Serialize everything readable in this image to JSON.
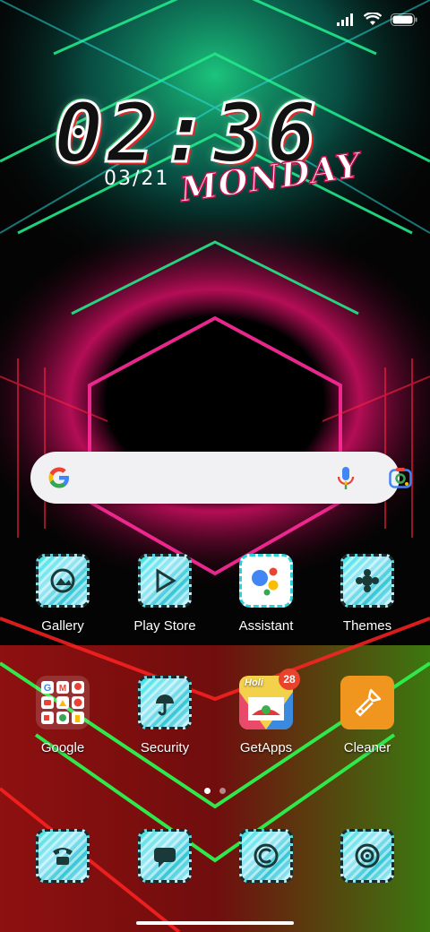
{
  "status_bar": {
    "icons": [
      "signal-icon",
      "wifi-icon",
      "battery-icon"
    ]
  },
  "clock_widget": {
    "time": "02:36",
    "date": "03/21",
    "day": "MONDAY"
  },
  "search_bar": {
    "icons": [
      "google-g-icon",
      "microphone-icon",
      "google-lens-icon"
    ]
  },
  "home_apps": [
    {
      "label": "Gallery",
      "icon": "gallery-icon"
    },
    {
      "label": "Play Store",
      "icon": "play-store-icon"
    },
    {
      "label": "Assistant",
      "icon": "assistant-icon"
    },
    {
      "label": "Themes",
      "icon": "themes-icon"
    },
    {
      "label": "Google",
      "icon": "google-folder-icon"
    },
    {
      "label": "Security",
      "icon": "security-icon"
    },
    {
      "label": "GetApps",
      "icon": "getapps-icon",
      "badge": "28",
      "icon_text": "Holi"
    },
    {
      "label": "Cleaner",
      "icon": "cleaner-icon"
    }
  ],
  "page_indicator": {
    "pages": 2,
    "current": 1
  },
  "dock_apps": [
    {
      "icon": "phone-icon"
    },
    {
      "icon": "messages-icon"
    },
    {
      "icon": "browser-icon"
    },
    {
      "icon": "camera-icon"
    }
  ],
  "colors": {
    "neon_green": "#27e85c",
    "neon_cyan": "#2de0c8",
    "neon_magenta": "#ff1e8c",
    "neon_red": "#ff1e1e",
    "cleaner_orange": "#f0961e",
    "badge_red": "#e8432d"
  }
}
